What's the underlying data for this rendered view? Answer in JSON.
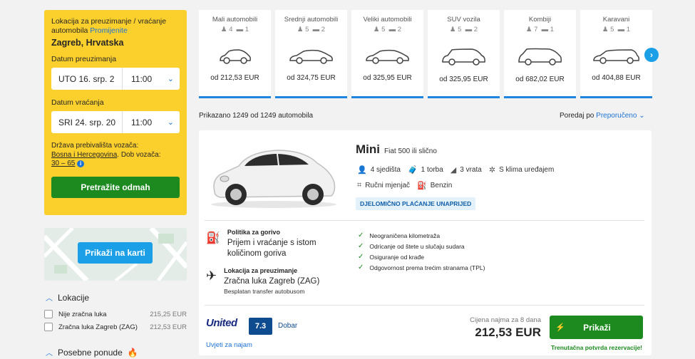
{
  "sidebar": {
    "pickup_title": "Lokacija za preuzimanje / vraćanje automobila",
    "change_link": "Promijenite",
    "city": "Zagreb, Hrvatska",
    "pickup_date_label": "Datum preuzimanja",
    "pickup_date": "UTO 16. srp. 2",
    "pickup_time": "11:00",
    "return_date_label": "Datum vraćanja",
    "return_date": "SRI 24. srp. 20",
    "return_time": "11:00",
    "residence_label": "Država prebivališta vozača:",
    "residence_value": "Bosna i Hercegovina",
    "age_label": ". Dob vozača:",
    "age_value": "30 – 65",
    "search_button": "Pretražite odmah",
    "map_button": "Prikaži na karti",
    "locations_title": "Lokacije",
    "locations": [
      {
        "name": "Nije zračna luka",
        "price": "215,25 EUR"
      },
      {
        "name": "Zračna luka Zagreb (ZAG)",
        "price": "212,53 EUR"
      }
    ],
    "special_offers_title": "Posebne ponude"
  },
  "categories": [
    {
      "name": "Mali automobili",
      "seats": "4",
      "bags": "1",
      "price": "od 212,53 EUR"
    },
    {
      "name": "Srednji automobili",
      "seats": "5",
      "bags": "2",
      "price": "od 324,75 EUR"
    },
    {
      "name": "Veliki automobili",
      "seats": "5",
      "bags": "2",
      "price": "od 325,95 EUR"
    },
    {
      "name": "SUV vozila",
      "seats": "5",
      "bags": "2",
      "price": "od 325,95 EUR"
    },
    {
      "name": "Kombiji",
      "seats": "7",
      "bags": "1",
      "price": "od 682,02 EUR"
    },
    {
      "name": "Karavani",
      "seats": "5",
      "bags": "1",
      "price": "od 404,88 EUR"
    }
  ],
  "results": {
    "count_text": "Prikazano 1249 od 1249 automobila",
    "sort_label": "Poredaj po",
    "sort_value": "Preporučeno"
  },
  "offer": {
    "name": "Mini",
    "model": "Fiat 500 ili slično",
    "seats": "4 sjedišta",
    "bags": "1 torba",
    "doors": "3 vrata",
    "ac": "S klima uređajem",
    "transmission": "Ručni mjenjač",
    "fuel_type": "Benzin",
    "badge": "DJELOMIČNO PLAĆANJE UNAPRIJED",
    "fuel_policy_title": "Politika za gorivo",
    "fuel_policy": "Prijem i vraćanje s istom količinom goriva",
    "pickup_title": "Lokacija za preuzimanje",
    "pickup_location": "Zračna luka Zagreb (ZAG)",
    "pickup_note": "Besplatan transfer autobusom",
    "features": [
      "Neograničena kilometraža",
      "Odricanje od štete u slučaju sudara",
      "Osiguranje od krađe",
      "Odgovornost prema trećim stranama (TPL)"
    ],
    "supplier": "United",
    "score": "7.3",
    "rating": "Dobar",
    "terms_link": "Uvjeti za najam",
    "price_label": "Cijena najma za 8 dana",
    "price": "212,53 EUR",
    "show_button": "Prikaži",
    "confirmation": "Trenutačna potvrda rezervacije!"
  },
  "icons": {
    "next": "chevron-right-icon",
    "check": "check-icon",
    "fuel": "fuel-pump-icon",
    "plane": "airplane-icon"
  },
  "colors": {
    "accent_yellow": "#fcd02c",
    "primary_green": "#1c8a1f",
    "link_blue": "#1e73d6",
    "category_underline": "#1e86e0"
  }
}
